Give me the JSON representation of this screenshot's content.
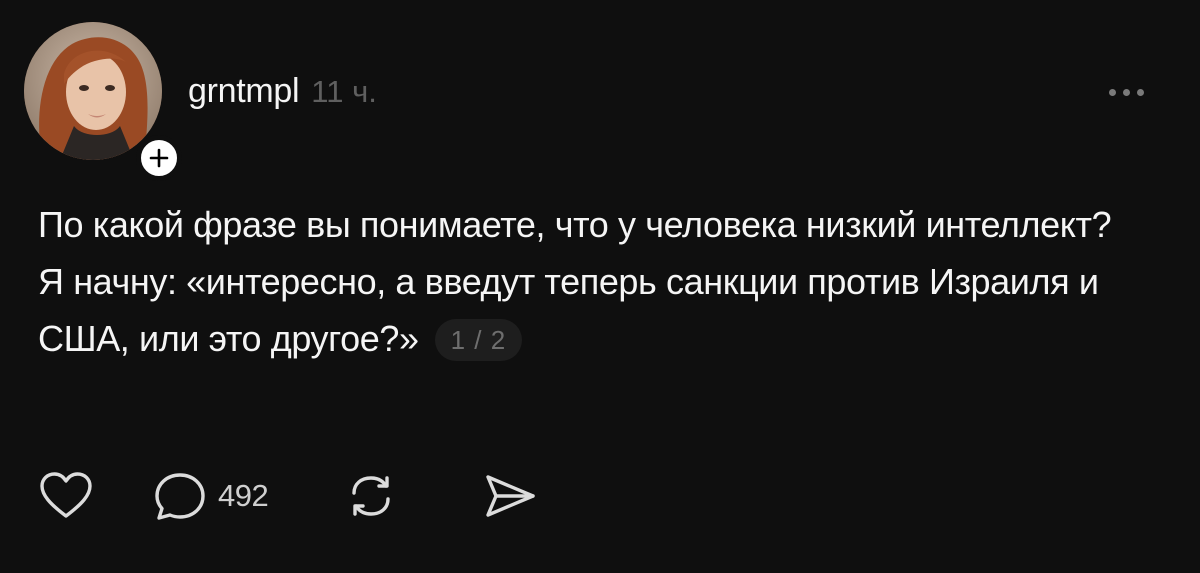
{
  "post": {
    "author": {
      "username": "grntmpl",
      "avatar_icon": "person-avatar",
      "follow_icon": "plus-icon"
    },
    "timestamp": "11 ч.",
    "menu_icon": "more-horizontal-icon",
    "text_lines": [
      "По какой фразе вы понимаете, что у человека низкий интеллект?",
      "Я начну: «интересно, а введут теперь санкции против Израиля и США, или это другое?»"
    ],
    "page_indicator": "1 / 2",
    "actions": {
      "like_icon": "heart-icon",
      "reply_icon": "comment-icon",
      "reply_count": "492",
      "repost_icon": "repost-icon",
      "share_icon": "send-icon"
    }
  },
  "colors": {
    "background": "#0f0f0f",
    "primary_text": "#f5f5f5",
    "secondary_text": "#5f5f5f",
    "icon": "#dcdcdc"
  }
}
